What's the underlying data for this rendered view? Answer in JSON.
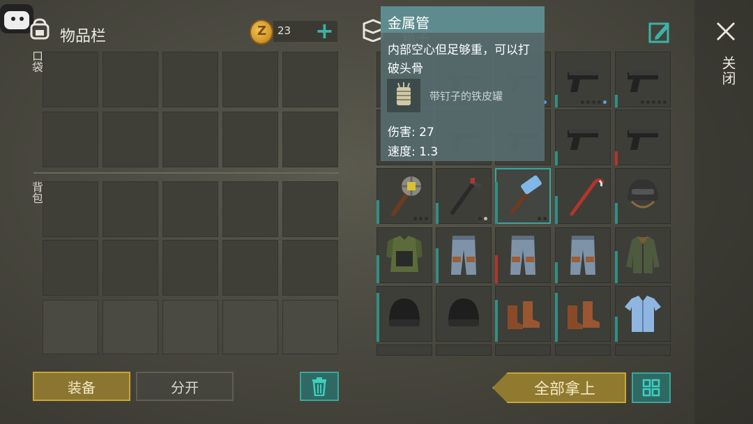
{
  "inventory": {
    "title": "物品栏",
    "pocket_label": "口袋",
    "backpack_label": "背包",
    "coins": "23"
  },
  "box": {
    "title": "箱子"
  },
  "close_label": "关闭",
  "tooltip": {
    "title": "金属管",
    "description": "内部空心但足够重，可以打破头骨",
    "ingredient": "带钉子的铁皮罐",
    "damage": "伤害: 27",
    "speed": "速度: 1.3"
  },
  "buttons": {
    "equip": "装备",
    "split": "分开",
    "take_all": "全部拿上"
  },
  "items": [
    [
      "pistol",
      "pistol",
      "pistol",
      "pistol",
      "pistol"
    ],
    [
      "pistol",
      "pistol",
      "pistol",
      "pistol",
      "pistol"
    ],
    [
      "spiked-club",
      "crowbar-hammer",
      "sledgehammer",
      "crowbar",
      "helmet"
    ],
    [
      "armor-vest",
      "jeans",
      "jeans",
      "jeans",
      "jacket"
    ],
    [
      "beanie",
      "beanie",
      "boots",
      "boots",
      "shirt"
    ]
  ],
  "colors": {
    "accent": "#3da59a",
    "gold": "#c9a63a",
    "durability_low": "#b3342b"
  }
}
